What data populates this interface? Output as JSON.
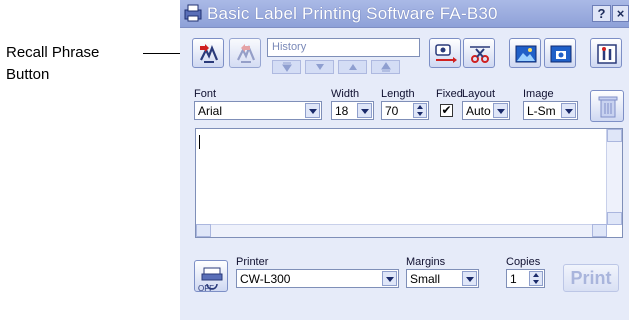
{
  "annotation": {
    "label_line1": "Recall Phrase",
    "label_line2": "Button"
  },
  "window": {
    "title": "Basic Label Printing Software FA-B30",
    "help_button": "?",
    "close_button": "×"
  },
  "toolbar": {
    "history_placeholder": "History",
    "history_nav": [
      "first",
      "down",
      "up",
      "last"
    ]
  },
  "settings": {
    "font_label": "Font",
    "font_value": "Arial",
    "width_label": "Width",
    "width_value": "18",
    "length_label": "Length",
    "length_value": "70",
    "fixed_label": "Fixed",
    "fixed_checked": "✔",
    "layout_label": "Layout",
    "layout_value": "Auto",
    "image_label": "Image",
    "image_value": "L-Sm"
  },
  "printer": {
    "printer_label": "Printer",
    "printer_value": "CW-L300",
    "off_label": "OFF",
    "margins_label": "Margins",
    "margins_value": "Small",
    "copies_label": "Copies",
    "copies_value": "1",
    "print_button": "Print"
  },
  "colors": {
    "accent": "#8ea1d8",
    "window_bg": "#e6ebf9",
    "red_arrow": "#d02020"
  }
}
